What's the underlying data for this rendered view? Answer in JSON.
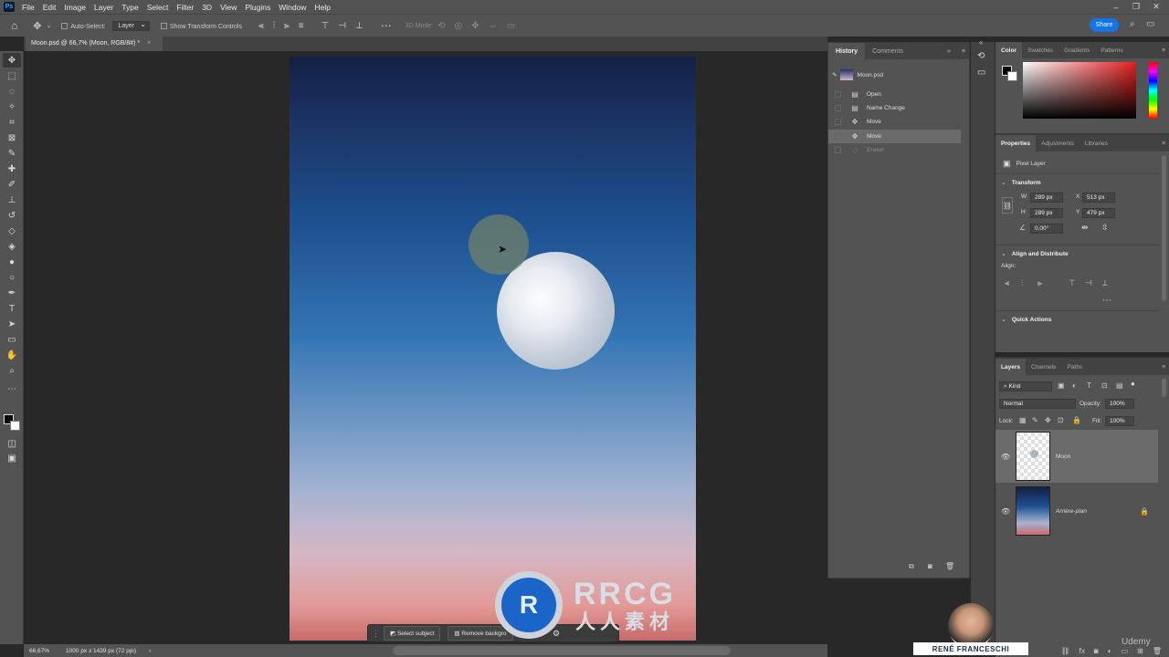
{
  "menubar": {
    "logo": "Ps",
    "items": [
      "File",
      "Edit",
      "Image",
      "Layer",
      "Type",
      "Select",
      "Filter",
      "3D",
      "View",
      "Plugins",
      "Window",
      "Help"
    ]
  },
  "options": {
    "auto_select": "Auto-Select:",
    "layer_select": "Layer",
    "show_transform": "Show Transform Controls",
    "mode_3d": "3D Mode:",
    "share": "Share"
  },
  "document": {
    "tab_title": "Moon.psd @ 66,7% (Moon, RGB/8#) *",
    "zoom": "66,67%",
    "size_info": "1000 px x 1439 px (72 ppi)"
  },
  "taskbar": {
    "select_subject": "Select subject",
    "remove_background": "Remove backgro"
  },
  "history": {
    "tabs": [
      "History",
      "Comments"
    ],
    "snapshot": "Moon.psd",
    "steps": [
      {
        "label": "Open",
        "state": "normal"
      },
      {
        "label": "Name Change",
        "state": "normal"
      },
      {
        "label": "Move",
        "state": "normal"
      },
      {
        "label": "Move",
        "state": "selected"
      },
      {
        "label": "Eraser",
        "state": "dimmed"
      }
    ]
  },
  "color_panel": {
    "tabs": [
      "Color",
      "Swatches",
      "Gradients",
      "Patterns"
    ],
    "accent_hue": "#e41e1e"
  },
  "properties": {
    "tabs": [
      "Properties",
      "Adjustments",
      "Libraries"
    ],
    "kind": "Pixel Layer",
    "transform_title": "Transform",
    "w_label": "W",
    "w_value": "289 px",
    "h_label": "H",
    "h_value": "289 px",
    "x_label": "X",
    "x_value": "513 px",
    "y_label": "Y",
    "y_value": "479 px",
    "angle": "0,00°",
    "align_title": "Align and Distribute",
    "align_label": "Align:",
    "quick_actions": "Quick Actions"
  },
  "layers": {
    "tabs": [
      "Layers",
      "Channels",
      "Paths"
    ],
    "kind_filter": "Kind",
    "blend_mode": "Normal",
    "opacity_label": "Opacity:",
    "opacity": "100%",
    "lock_label": "Lock:",
    "fill_label": "Fill:",
    "fill": "100%",
    "items": [
      {
        "name": "Moon",
        "selected": true
      },
      {
        "name": "Arrière-plan",
        "selected": false
      }
    ]
  },
  "overlay": {
    "instructor": "RENÉ FRANCESCHI",
    "watermark": "RRCG",
    "watermark_sub": "人人素材",
    "watermark_logo": "R",
    "platform": "Udemy"
  }
}
